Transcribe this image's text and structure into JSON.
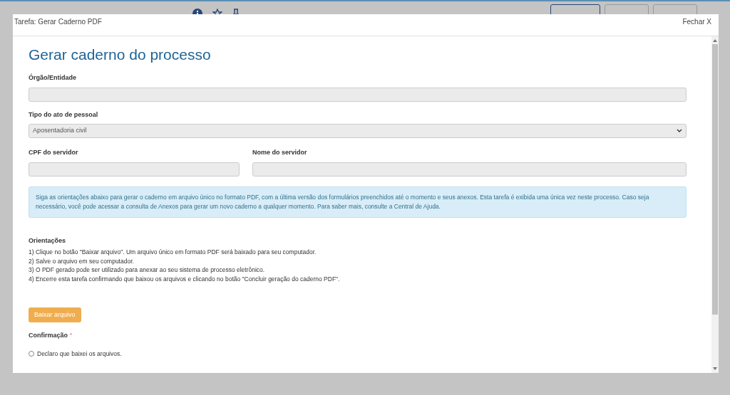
{
  "modal": {
    "title": "Tarefa: Gerar Caderno PDF",
    "close": "Fechar X",
    "heading": "Gerar caderno do processo",
    "fields": [
      {
        "kind": "input",
        "label": "Órgão/Entidade"
      },
      {
        "kind": "select",
        "label": "Tipo do ato de pessoal",
        "value": "Aposentadoria civil"
      }
    ],
    "row_fields": [
      {
        "label": "CPF do servidor"
      },
      {
        "label": "Nome do servidor"
      }
    ],
    "info": "Siga as orientações abaixo para gerar o caderno em arquivo único no formato PDF, com a última versão dos formulários preenchidos até o momento e seus anexos. Esta tarefa é exibida uma única vez neste processo. Caso seja necessário, você pode acessar a consulta de Anexos para gerar um novo caderno a qualquer momento. Para saber mais, consulte a Central de Ajuda.",
    "instructions_title": "Orientações",
    "instructions": [
      "1) Clique no botão \"Baixar arquivo\". Um arquivo único em formato PDF será baixado para seu computador.",
      "2) Salve o arquivo em seu computador.",
      "3) O PDF gerado pode ser utilizado para anexar ao seu sistema de processo eletrônico.",
      "4) Encerre esta tarefa confirmando que baixou os arquivos e clicando no botão \"Concluir geração do caderno PDF\"."
    ],
    "download_button": "Baixar arquivo",
    "confirmation": {
      "label": "Confirmação",
      "required_mark": "*",
      "option": "Declaro que baixei os arquivos.",
      "checked": false
    }
  }
}
